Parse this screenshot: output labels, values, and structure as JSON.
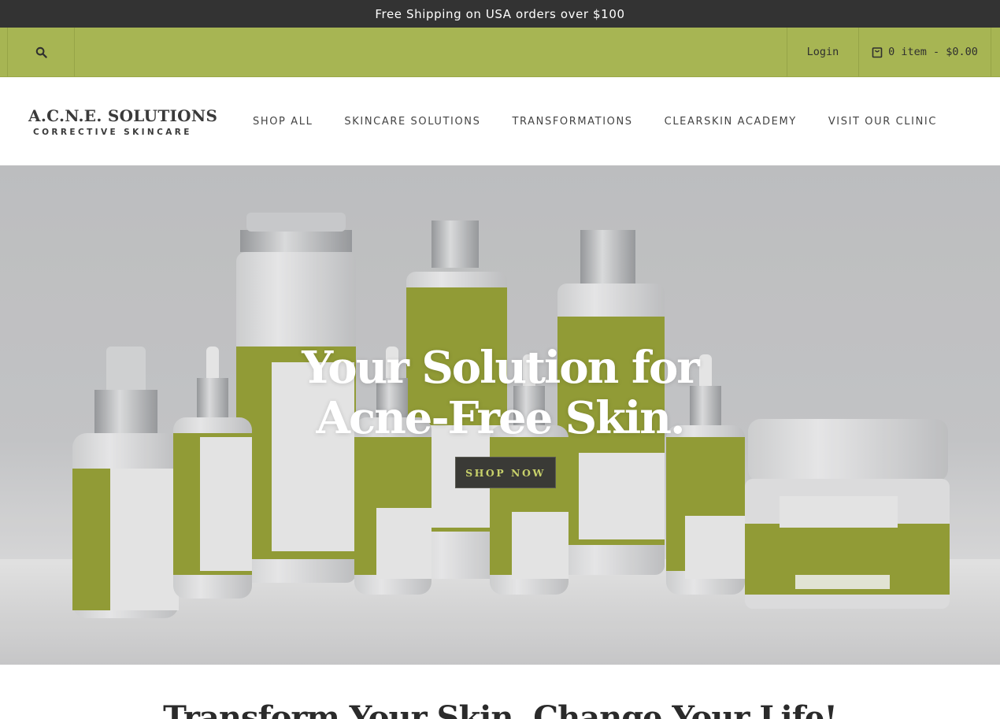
{
  "announcement": "Free Shipping on USA orders over $100",
  "utility": {
    "search_icon": "search-icon",
    "login_label": "Login",
    "cart_icon": "bag-icon",
    "cart_label": "0 item - $0.00"
  },
  "logo": {
    "main": "A.C.N.E. SOLUTIONS",
    "sub": "CORRECTIVE SKINCARE"
  },
  "nav": {
    "items": [
      {
        "label": "SHOP ALL"
      },
      {
        "label": "SKINCARE SOLUTIONS"
      },
      {
        "label": "TRANSFORMATIONS"
      },
      {
        "label": "CLEARSKIN ACADEMY"
      },
      {
        "label": "VISIT OUR CLINIC"
      }
    ]
  },
  "hero": {
    "title_line1": "Your Solution for",
    "title_line2": "Acne-Free Skin.",
    "button_label": "SHOP NOW",
    "image_alt": "A.C.N.E. Solutions product line on reflective surface"
  },
  "section": {
    "title": "Transform Your Skin, Change Your Life!"
  },
  "colors": {
    "announcement_bg": "#333333",
    "utility_bg": "#a7b553",
    "accent_olive": "#9ba53a",
    "button_bg": "#3a3a36",
    "button_text": "#c7d06a"
  }
}
